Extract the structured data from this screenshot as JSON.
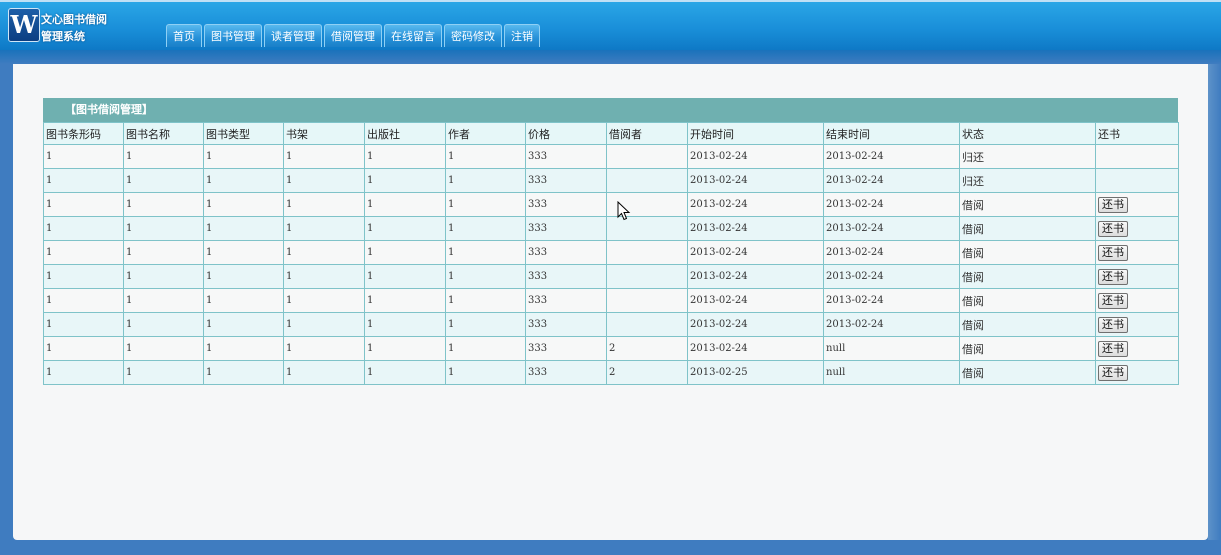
{
  "header": {
    "logo_letter": "W",
    "title_line1": "文心图书借阅",
    "title_line2": "管理系统"
  },
  "nav": [
    {
      "label": "首页"
    },
    {
      "label": "图书管理"
    },
    {
      "label": "读者管理"
    },
    {
      "label": "借阅管理"
    },
    {
      "label": "在线留言"
    },
    {
      "label": "密码修改"
    },
    {
      "label": "注销"
    }
  ],
  "table": {
    "caption": "【图书借阅管理】",
    "columns": [
      "图书条形码",
      "图书名称",
      "图书类型",
      "书架",
      "出版社",
      "作者",
      "价格",
      "借阅者",
      "开始时间",
      "结束时间",
      "状态",
      "还书"
    ],
    "return_label": "还书",
    "rows": [
      {
        "barcode": "1",
        "name": "1",
        "type": "1",
        "shelf": "1",
        "publisher": "1",
        "author": "1",
        "price": "333",
        "borrower": "",
        "start": "2013-02-24",
        "end": "2013-02-24",
        "status": "归还",
        "returnable": false
      },
      {
        "barcode": "1",
        "name": "1",
        "type": "1",
        "shelf": "1",
        "publisher": "1",
        "author": "1",
        "price": "333",
        "borrower": "",
        "start": "2013-02-24",
        "end": "2013-02-24",
        "status": "归还",
        "returnable": false
      },
      {
        "barcode": "1",
        "name": "1",
        "type": "1",
        "shelf": "1",
        "publisher": "1",
        "author": "1",
        "price": "333",
        "borrower": "",
        "start": "2013-02-24",
        "end": "2013-02-24",
        "status": "借阅",
        "returnable": true
      },
      {
        "barcode": "1",
        "name": "1",
        "type": "1",
        "shelf": "1",
        "publisher": "1",
        "author": "1",
        "price": "333",
        "borrower": "",
        "start": "2013-02-24",
        "end": "2013-02-24",
        "status": "借阅",
        "returnable": true
      },
      {
        "barcode": "1",
        "name": "1",
        "type": "1",
        "shelf": "1",
        "publisher": "1",
        "author": "1",
        "price": "333",
        "borrower": "",
        "start": "2013-02-24",
        "end": "2013-02-24",
        "status": "借阅",
        "returnable": true
      },
      {
        "barcode": "1",
        "name": "1",
        "type": "1",
        "shelf": "1",
        "publisher": "1",
        "author": "1",
        "price": "333",
        "borrower": "",
        "start": "2013-02-24",
        "end": "2013-02-24",
        "status": "借阅",
        "returnable": true
      },
      {
        "barcode": "1",
        "name": "1",
        "type": "1",
        "shelf": "1",
        "publisher": "1",
        "author": "1",
        "price": "333",
        "borrower": "",
        "start": "2013-02-24",
        "end": "2013-02-24",
        "status": "借阅",
        "returnable": true
      },
      {
        "barcode": "1",
        "name": "1",
        "type": "1",
        "shelf": "1",
        "publisher": "1",
        "author": "1",
        "price": "333",
        "borrower": "",
        "start": "2013-02-24",
        "end": "2013-02-24",
        "status": "借阅",
        "returnable": true
      },
      {
        "barcode": "1",
        "name": "1",
        "type": "1",
        "shelf": "1",
        "publisher": "1",
        "author": "1",
        "price": "333",
        "borrower": "2",
        "start": "2013-02-24",
        "end": "null",
        "status": "借阅",
        "returnable": true
      },
      {
        "barcode": "1",
        "name": "1",
        "type": "1",
        "shelf": "1",
        "publisher": "1",
        "author": "1",
        "price": "333",
        "borrower": "2",
        "start": "2013-02-25",
        "end": "null",
        "status": "借阅",
        "returnable": true
      }
    ]
  },
  "colors": {
    "header_blue": "#1a8fd9",
    "caption_teal": "#6fb0b0",
    "border_teal": "#7fc3c9",
    "page_blue": "#3f7cc0"
  }
}
